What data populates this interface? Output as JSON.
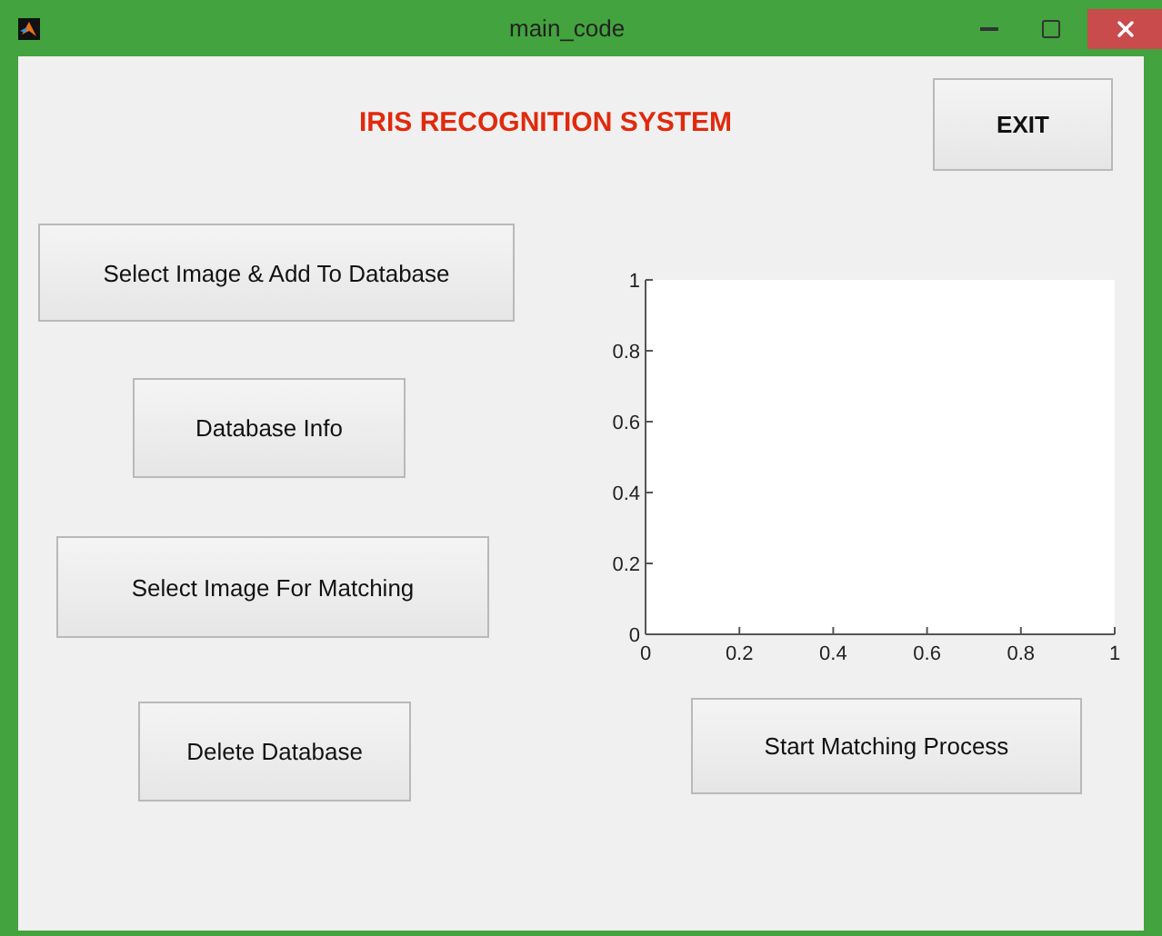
{
  "window": {
    "title": "main_code"
  },
  "heading": "IRIS RECOGNITION SYSTEM",
  "buttons": [
    {
      "label": "EXIT",
      "kind": "exit"
    },
    {
      "label": "Select Image & Add To Database",
      "kind": "add"
    },
    {
      "label": "Database Info",
      "kind": "info"
    },
    {
      "label": "Select Image For Matching",
      "kind": "select"
    },
    {
      "label": "Delete Database",
      "kind": "delete"
    },
    {
      "label": "Start Matching Process",
      "kind": "match"
    }
  ],
  "axes": {
    "chart_data": {
      "type": "line",
      "xlim": [
        0,
        1
      ],
      "ylim": [
        0,
        1
      ],
      "xticks": [
        0,
        0.2,
        0.4,
        0.6,
        0.8,
        1
      ],
      "yticks": [
        0,
        0.2,
        0.4,
        0.6,
        0.8,
        1
      ]
    }
  }
}
